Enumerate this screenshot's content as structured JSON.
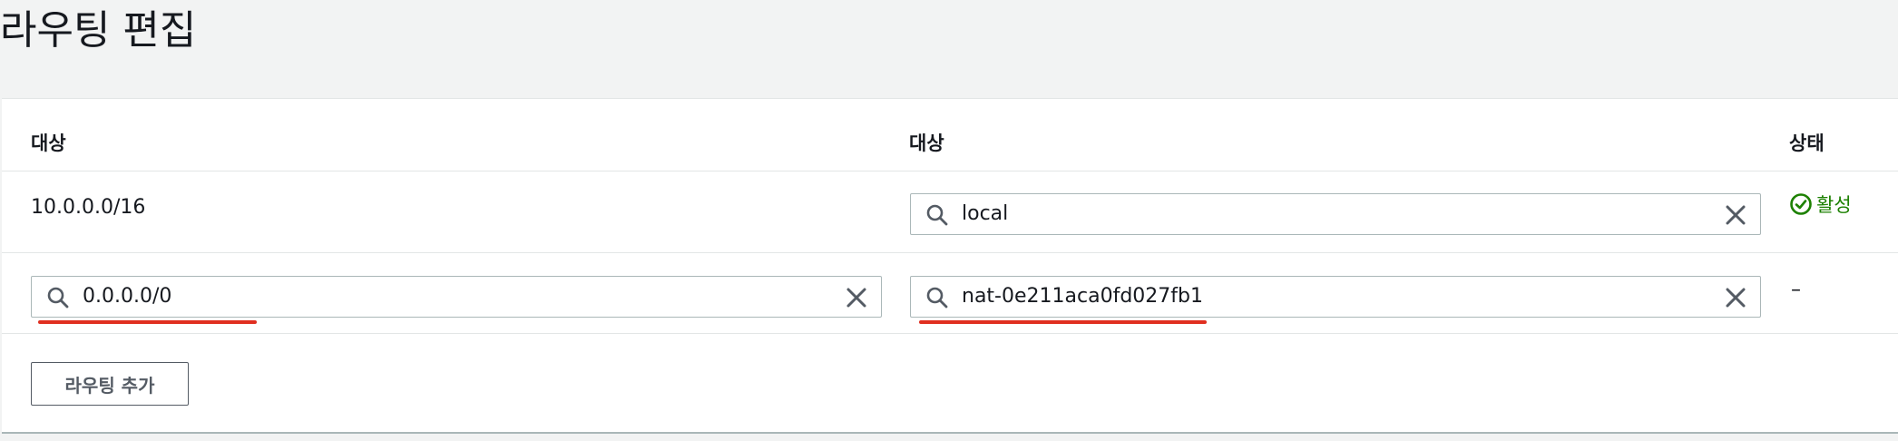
{
  "page": {
    "title": "라우팅 편집"
  },
  "table": {
    "headers": [
      "대상",
      "대상",
      "상태"
    ],
    "rows": [
      {
        "destination": "10.0.0.0/16",
        "target": "local",
        "status": "활성"
      },
      {
        "destination": "0.0.0.0/0",
        "target": "nat-0e211aca0fd027fb1",
        "status": "–"
      }
    ]
  },
  "actions": {
    "add_route_label": "라우팅 추가"
  },
  "colors": {
    "status_active": "#1d8102",
    "validation_underline": "#e02f20",
    "input_border": "#aab7b8",
    "background": "#f2f3f3"
  },
  "icons": {
    "search": "search-icon",
    "clear": "close-icon",
    "status_active": "check-circle-icon"
  }
}
